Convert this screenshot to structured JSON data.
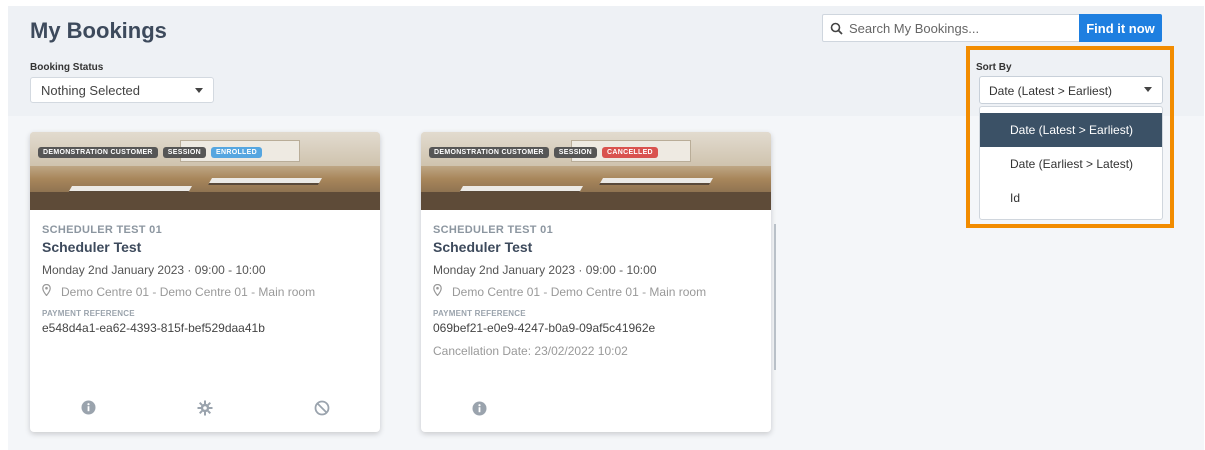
{
  "header": {
    "title": "My Bookings",
    "search": {
      "placeholder": "Search My Bookings...",
      "button_label": "Find it now"
    }
  },
  "filters": {
    "booking_status": {
      "label": "Booking Status",
      "value": "Nothing Selected"
    },
    "sort_by": {
      "label": "Sort By",
      "value": "Date (Latest > Earliest)",
      "options": [
        "Date (Latest > Earliest)",
        "Date (Earliest > Latest)",
        "Id"
      ],
      "highlight_color": "#f28c00"
    }
  },
  "cards": [
    {
      "tags": [
        "DEMONSTRATION CUSTOMER",
        "SESSION",
        "ENROLLED"
      ],
      "course_code": "SCHEDULER TEST 01",
      "course_name": "Scheduler Test",
      "datetime": "Monday 2nd January 2023 · 09:00 - 10:00",
      "location": "Demo Centre 01 - Demo Centre 01 - Main room",
      "payment_label": "PAYMENT REFERENCE",
      "payment_reference": "e548d4a1-ea62-4393-815f-bef529daa41b",
      "actions": [
        "info-icon",
        "gear-icon",
        "cancel-icon"
      ]
    },
    {
      "tags": [
        "DEMONSTRATION CUSTOMER",
        "SESSION",
        "CANCELLED"
      ],
      "course_code": "SCHEDULER TEST 01",
      "course_name": "Scheduler Test",
      "datetime": "Monday 2nd January 2023 · 09:00 - 10:00",
      "location": "Demo Centre 01 - Demo Centre 01 - Main room",
      "payment_label": "PAYMENT REFERENCE",
      "payment_reference": "069bef21-e0e9-4247-b0a9-09af5c41962e",
      "cancellation": "Cancellation Date: 23/02/2022 10:02",
      "actions": [
        "info-icon"
      ]
    }
  ],
  "colors": {
    "primary_button": "#1e7fe0",
    "enrolled": "#56a6e0",
    "cancelled": "#d9534f",
    "selected_option": "#3b5166"
  }
}
